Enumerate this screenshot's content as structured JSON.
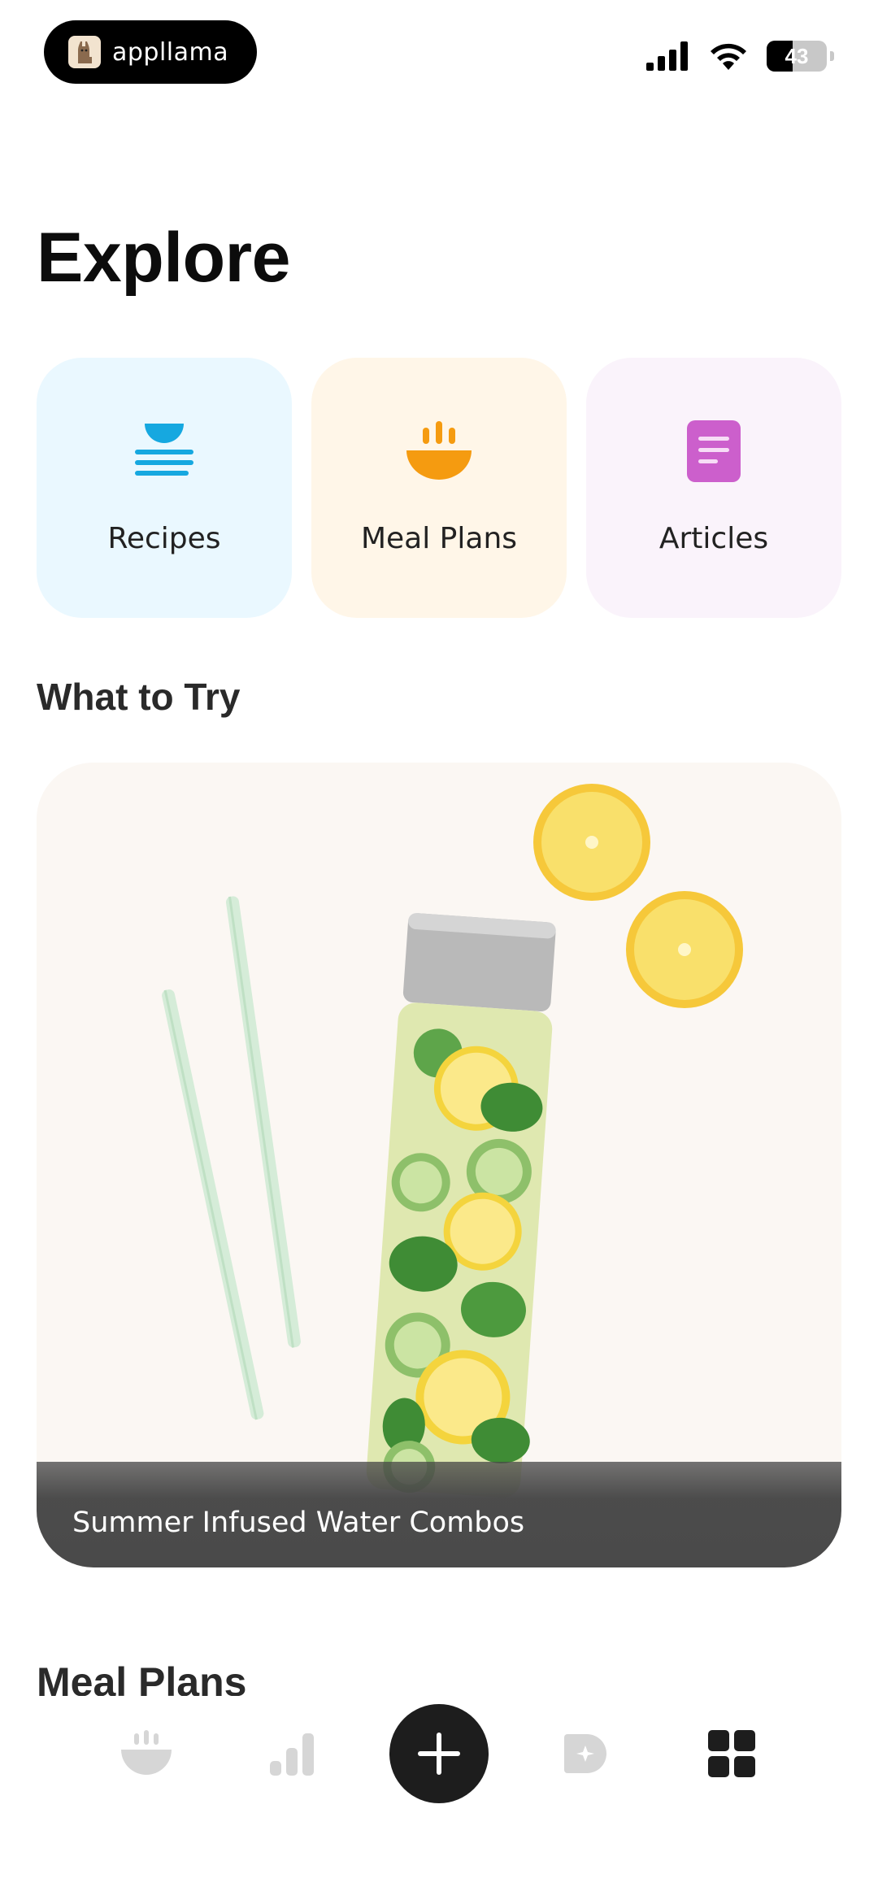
{
  "status_bar": {
    "app_badge_text": "appllama",
    "battery_level": "43"
  },
  "page": {
    "title": "Explore"
  },
  "categories": [
    {
      "label": "Recipes",
      "icon": "bowl-lines-icon",
      "color": "#16a8e0"
    },
    {
      "label": "Meal Plans",
      "icon": "steaming-bowl-icon",
      "color": "#f59b10"
    },
    {
      "label": "Articles",
      "icon": "document-icon",
      "color": "#cc5fcc"
    }
  ],
  "what_to_try": {
    "heading": "What to Try",
    "featured_title": "Summer Infused Water Combos"
  },
  "next_section": {
    "heading": "Meal Plans"
  },
  "tabbar": {
    "items": [
      {
        "icon": "bowl-icon"
      },
      {
        "icon": "bar-chart-icon"
      },
      {
        "icon": "add-icon"
      },
      {
        "icon": "tag-sparkle-icon"
      },
      {
        "icon": "grid-icon"
      }
    ]
  }
}
